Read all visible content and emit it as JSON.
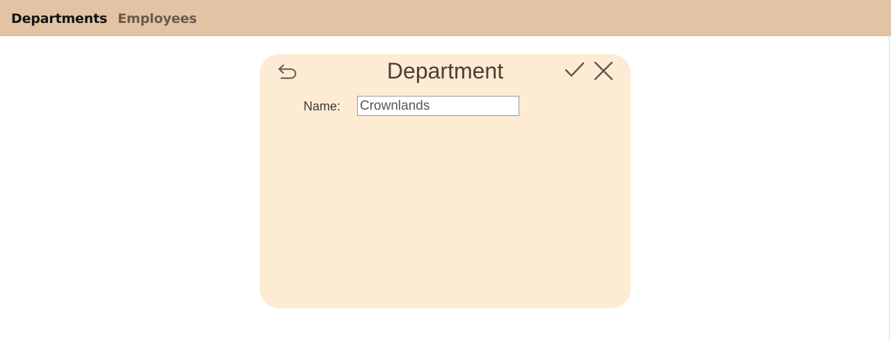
{
  "nav": {
    "items": [
      {
        "label": "Departments"
      },
      {
        "label": "Employees"
      }
    ]
  },
  "dialog": {
    "title": "Department",
    "icons": {
      "back": "undo-arrow-icon",
      "confirm": "checkmark-icon",
      "close": "close-icon"
    },
    "fields": {
      "name": {
        "label": "Name:",
        "value": "Crownlands"
      }
    }
  },
  "colors": {
    "topbar": "#e2c4a4",
    "card": "#fdebd3",
    "nav_active": "#141414",
    "nav_inactive": "#6a5a4b"
  }
}
